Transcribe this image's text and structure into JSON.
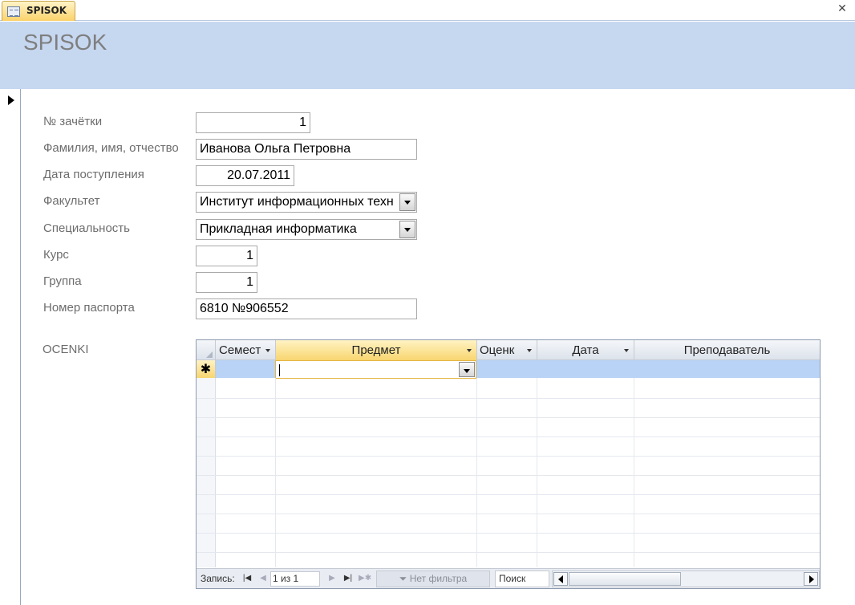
{
  "tab": {
    "label": "SPISOK"
  },
  "header": {
    "title": "SPISOK"
  },
  "form": {
    "fields": [
      {
        "label": "№ зачётки",
        "value": "1"
      },
      {
        "label": "Фамилия, имя, отчество",
        "value": "Иванова Ольга Петровна"
      },
      {
        "label": "Дата поступления",
        "value": "20.07.2011"
      },
      {
        "label": "Факультет",
        "value": "Институт информационных техн"
      },
      {
        "label": "Специальность",
        "value": "Прикладная информатика"
      },
      {
        "label": "Курс",
        "value": "1"
      },
      {
        "label": "Группа",
        "value": "1"
      },
      {
        "label": "Номер паспорта",
        "value": "6810 №906552"
      }
    ]
  },
  "subform": {
    "label": "OCENKI",
    "columns": [
      "Семест",
      "Предмет",
      "Оценк",
      "Дата",
      "Преподаватель"
    ],
    "new_row_marker": "✱",
    "nav": {
      "record_label": "Запись:",
      "position": "1 из 1",
      "filter_label": "Нет фильтра",
      "search_label": "Поиск"
    }
  },
  "icons": [
    "form-icon",
    "close-icon",
    "record-selector-arrow-icon",
    "dropdown-arrow-icon",
    "nav-first-icon",
    "nav-prev-icon",
    "nav-next-icon",
    "nav-last-icon",
    "nav-new-icon",
    "filter-icon",
    "scroll-left-icon",
    "scroll-right-icon"
  ]
}
